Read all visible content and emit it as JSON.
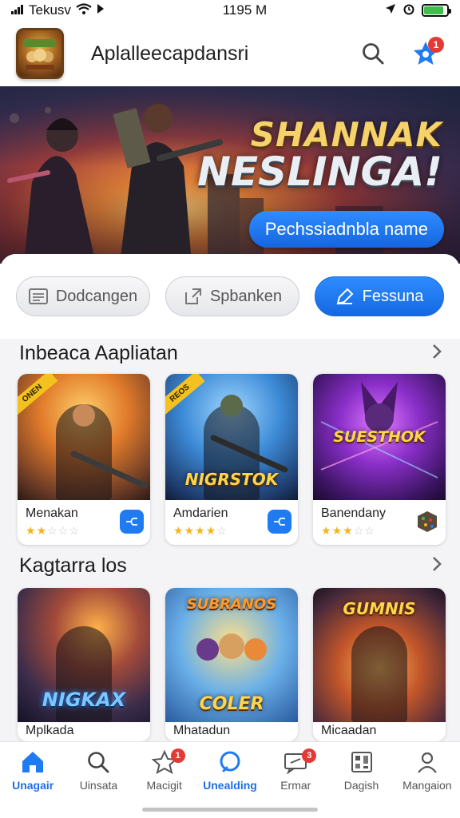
{
  "status_bar": {
    "carrier": "Tekusv",
    "time": "1195 M"
  },
  "header": {
    "app_title": "Aplalleecapdansri",
    "notification_count": "1"
  },
  "hero": {
    "title_line1": "SHANNAK",
    "title_line2": "NESLINGA!",
    "cta_label": "Pechssiadnbla name"
  },
  "segments": [
    {
      "label": "Dodcangen",
      "active": false
    },
    {
      "label": "Spbanken",
      "active": false
    },
    {
      "label": "Fessuna",
      "active": true
    }
  ],
  "section1": {
    "title": "Inbeaca Aapliatan",
    "cards": [
      {
        "name": "Menakan",
        "rating": 2,
        "art_text": "",
        "corner": "ONEN"
      },
      {
        "name": "Amdarien",
        "rating": 4,
        "art_text": "NIGRSTOK",
        "corner": "REOS"
      },
      {
        "name": "Banendany",
        "rating": 3,
        "art_text": "SUESTHOK",
        "corner": ""
      }
    ]
  },
  "section2": {
    "title": "Kagtarra los",
    "cards": [
      {
        "name": "Mplkada",
        "art_text": "NIGKAX"
      },
      {
        "name": "Mhatadun",
        "art_text": "COLER",
        "top_text": "SUBRANOS"
      },
      {
        "name": "Micaadan",
        "art_text": "",
        "top_text": "GUMNIS"
      }
    ]
  },
  "nav": [
    {
      "label": "Unagair",
      "active": true,
      "badge": ""
    },
    {
      "label": "Uinsata",
      "active": false,
      "badge": ""
    },
    {
      "label": "Macigit",
      "active": false,
      "badge": "1"
    },
    {
      "label": "Unealding",
      "active": true,
      "badge": ""
    },
    {
      "label": "Ermar",
      "active": false,
      "badge": "3"
    },
    {
      "label": "Dagish",
      "active": false,
      "badge": ""
    },
    {
      "label": "Mangaion",
      "active": false,
      "badge": ""
    }
  ],
  "colors": {
    "accent": "#1f7bf2",
    "badge": "#e53935",
    "star": "#f3b619"
  },
  "icons": {
    "header": [
      "search-icon",
      "star-icon"
    ],
    "segments": [
      "list-icon",
      "share-icon",
      "edit-icon"
    ],
    "nav": [
      "home-icon",
      "search-icon",
      "star-icon",
      "chat-bubble-icon",
      "message-icon",
      "grid-icon",
      "profile-icon"
    ]
  }
}
